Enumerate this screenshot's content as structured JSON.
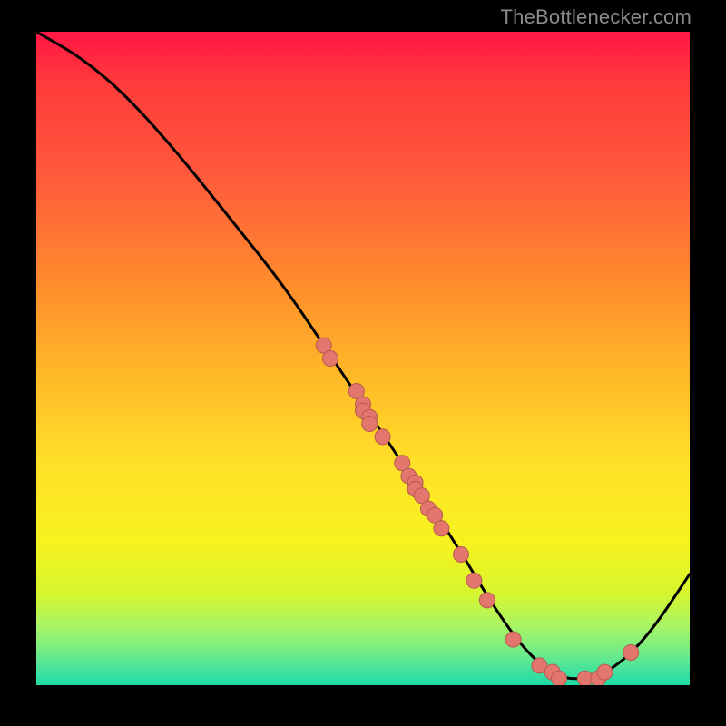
{
  "watermark": "TheBottlenecker.com",
  "chart_data": {
    "type": "line",
    "title": "",
    "xlabel": "",
    "ylabel": "",
    "xlim": [
      0,
      100
    ],
    "ylim": [
      0,
      100
    ],
    "curve": [
      {
        "x": 0,
        "y": 100
      },
      {
        "x": 7,
        "y": 96
      },
      {
        "x": 14,
        "y": 90
      },
      {
        "x": 22,
        "y": 81
      },
      {
        "x": 30,
        "y": 71
      },
      {
        "x": 38,
        "y": 61
      },
      {
        "x": 46,
        "y": 49
      },
      {
        "x": 52,
        "y": 40
      },
      {
        "x": 58,
        "y": 31
      },
      {
        "x": 64,
        "y": 22
      },
      {
        "x": 70,
        "y": 12
      },
      {
        "x": 75,
        "y": 5
      },
      {
        "x": 80,
        "y": 1
      },
      {
        "x": 85,
        "y": 1
      },
      {
        "x": 89,
        "y": 3
      },
      {
        "x": 94,
        "y": 8
      },
      {
        "x": 100,
        "y": 17
      }
    ],
    "series": [
      {
        "name": "data-points",
        "points": [
          {
            "x": 44,
            "y": 52
          },
          {
            "x": 45,
            "y": 50
          },
          {
            "x": 49,
            "y": 45
          },
          {
            "x": 50,
            "y": 43
          },
          {
            "x": 50,
            "y": 42
          },
          {
            "x": 51,
            "y": 41
          },
          {
            "x": 51,
            "y": 40
          },
          {
            "x": 53,
            "y": 38
          },
          {
            "x": 56,
            "y": 34
          },
          {
            "x": 57,
            "y": 32
          },
          {
            "x": 58,
            "y": 31
          },
          {
            "x": 58,
            "y": 30
          },
          {
            "x": 59,
            "y": 29
          },
          {
            "x": 60,
            "y": 27
          },
          {
            "x": 61,
            "y": 26
          },
          {
            "x": 62,
            "y": 24
          },
          {
            "x": 65,
            "y": 20
          },
          {
            "x": 67,
            "y": 16
          },
          {
            "x": 69,
            "y": 13
          },
          {
            "x": 73,
            "y": 7
          },
          {
            "x": 77,
            "y": 3
          },
          {
            "x": 79,
            "y": 2
          },
          {
            "x": 80,
            "y": 1
          },
          {
            "x": 84,
            "y": 1
          },
          {
            "x": 86,
            "y": 1
          },
          {
            "x": 87,
            "y": 2
          },
          {
            "x": 91,
            "y": 5
          }
        ]
      }
    ],
    "colors": {
      "curve": "#000000",
      "point_fill": "#e4776d",
      "point_stroke": "#b55a50"
    }
  }
}
